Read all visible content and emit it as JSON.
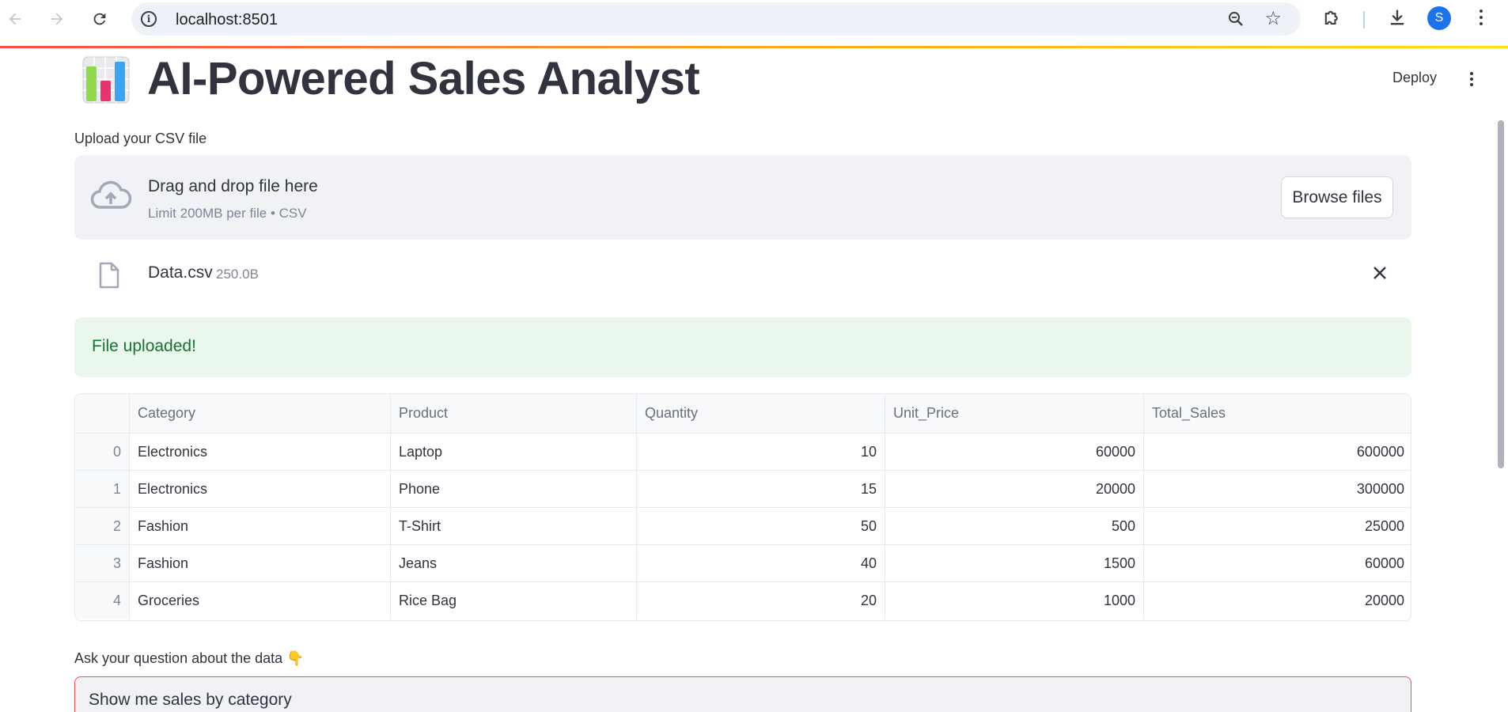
{
  "browser": {
    "url": "localhost:8501",
    "avatar_letter": "S"
  },
  "app": {
    "title": "AI-Powered Sales Analyst",
    "deploy_label": "Deploy"
  },
  "uploader": {
    "label": "Upload your CSV file",
    "drop_title": "Drag and drop file here",
    "drop_subtitle": "Limit 200MB per file • CSV",
    "browse_label": "Browse files",
    "file": {
      "name": "Data.csv",
      "size": "250.0B"
    }
  },
  "alert": {
    "message": "File uploaded!"
  },
  "table": {
    "columns": [
      "Category",
      "Product",
      "Quantity",
      "Unit_Price",
      "Total_Sales"
    ],
    "rows": [
      {
        "index": "0",
        "cells": [
          "Electronics",
          "Laptop",
          "10",
          "60000",
          "600000"
        ]
      },
      {
        "index": "1",
        "cells": [
          "Electronics",
          "Phone",
          "15",
          "20000",
          "300000"
        ]
      },
      {
        "index": "2",
        "cells": [
          "Fashion",
          "T-Shirt",
          "50",
          "500",
          "25000"
        ]
      },
      {
        "index": "3",
        "cells": [
          "Fashion",
          "Jeans",
          "40",
          "1500",
          "60000"
        ]
      },
      {
        "index": "4",
        "cells": [
          "Groceries",
          "Rice Bag",
          "20",
          "1000",
          "20000"
        ]
      }
    ]
  },
  "question": {
    "label": "Ask your question about the data 👇",
    "value": "Show me sales by category"
  },
  "colors": {
    "accent": "#ff4b4b",
    "success_bg": "#e9f7ec",
    "success_text": "#177233"
  }
}
